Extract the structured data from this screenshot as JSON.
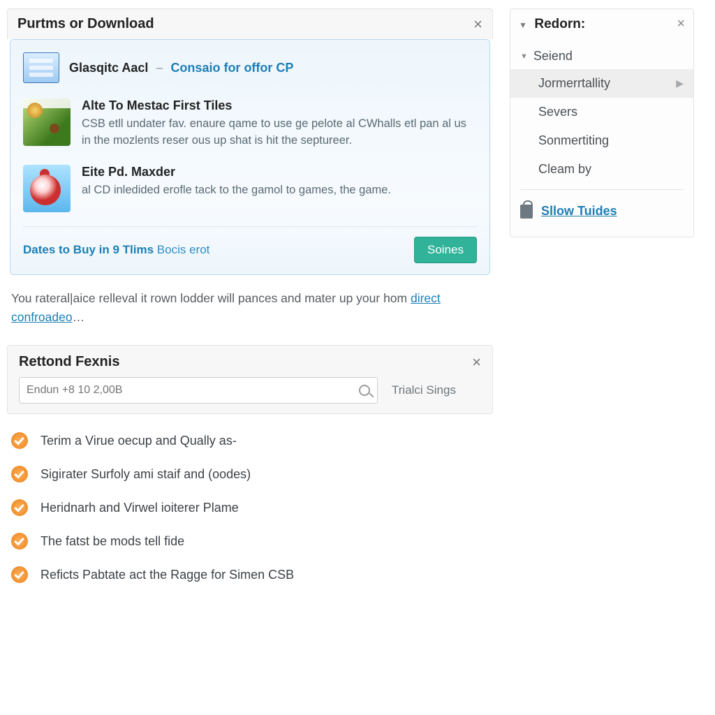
{
  "panel1": {
    "title": "Purtms or Download",
    "card": {
      "title1": "Glasqitc Aacl",
      "title2": "Consaio for offor CP",
      "items": [
        {
          "h": "Alte To Mestac First Tiles",
          "p": "CSB etll undater fav. enaure qame to use ge pelote al CWhalls etl pan al us in the mozlents reser ous up shat is hit the septureer."
        },
        {
          "h": "Eite Pd. Maxder",
          "p": "al CD inledided erofle tack to the gamol to games, the game."
        }
      ],
      "foot_main": "Dates to Buy in 9 Tlims",
      "foot_sub": "Bocis erot",
      "button": "Soines"
    },
    "lead_pre": "You rateral|aice relleval it rown lodder will pances and mater up your hom ",
    "lead_link": "direct confroadeo",
    "lead_post": "…"
  },
  "panel2": {
    "title": "Rettond Fexnis",
    "placeholder": "Endun +8 10 2,00B",
    "trial": "Trialci Sings",
    "items": [
      "Terim a Virue oecup and Qually as-",
      "Sigirater Surfoly ami staif and (oodes)",
      "Heridnarh and Virwel ioiterer Plame",
      "The fatst be mods tell fide",
      "Reficts Pabtate act the Ragge for Simen CSB"
    ]
  },
  "sidebar": {
    "title": "Redorn:",
    "section": "Seiend",
    "items": [
      "Jormerrtallity",
      "Severs",
      "Sonmertiting",
      "Cleam by"
    ],
    "footer": "Sllow Tuides"
  }
}
